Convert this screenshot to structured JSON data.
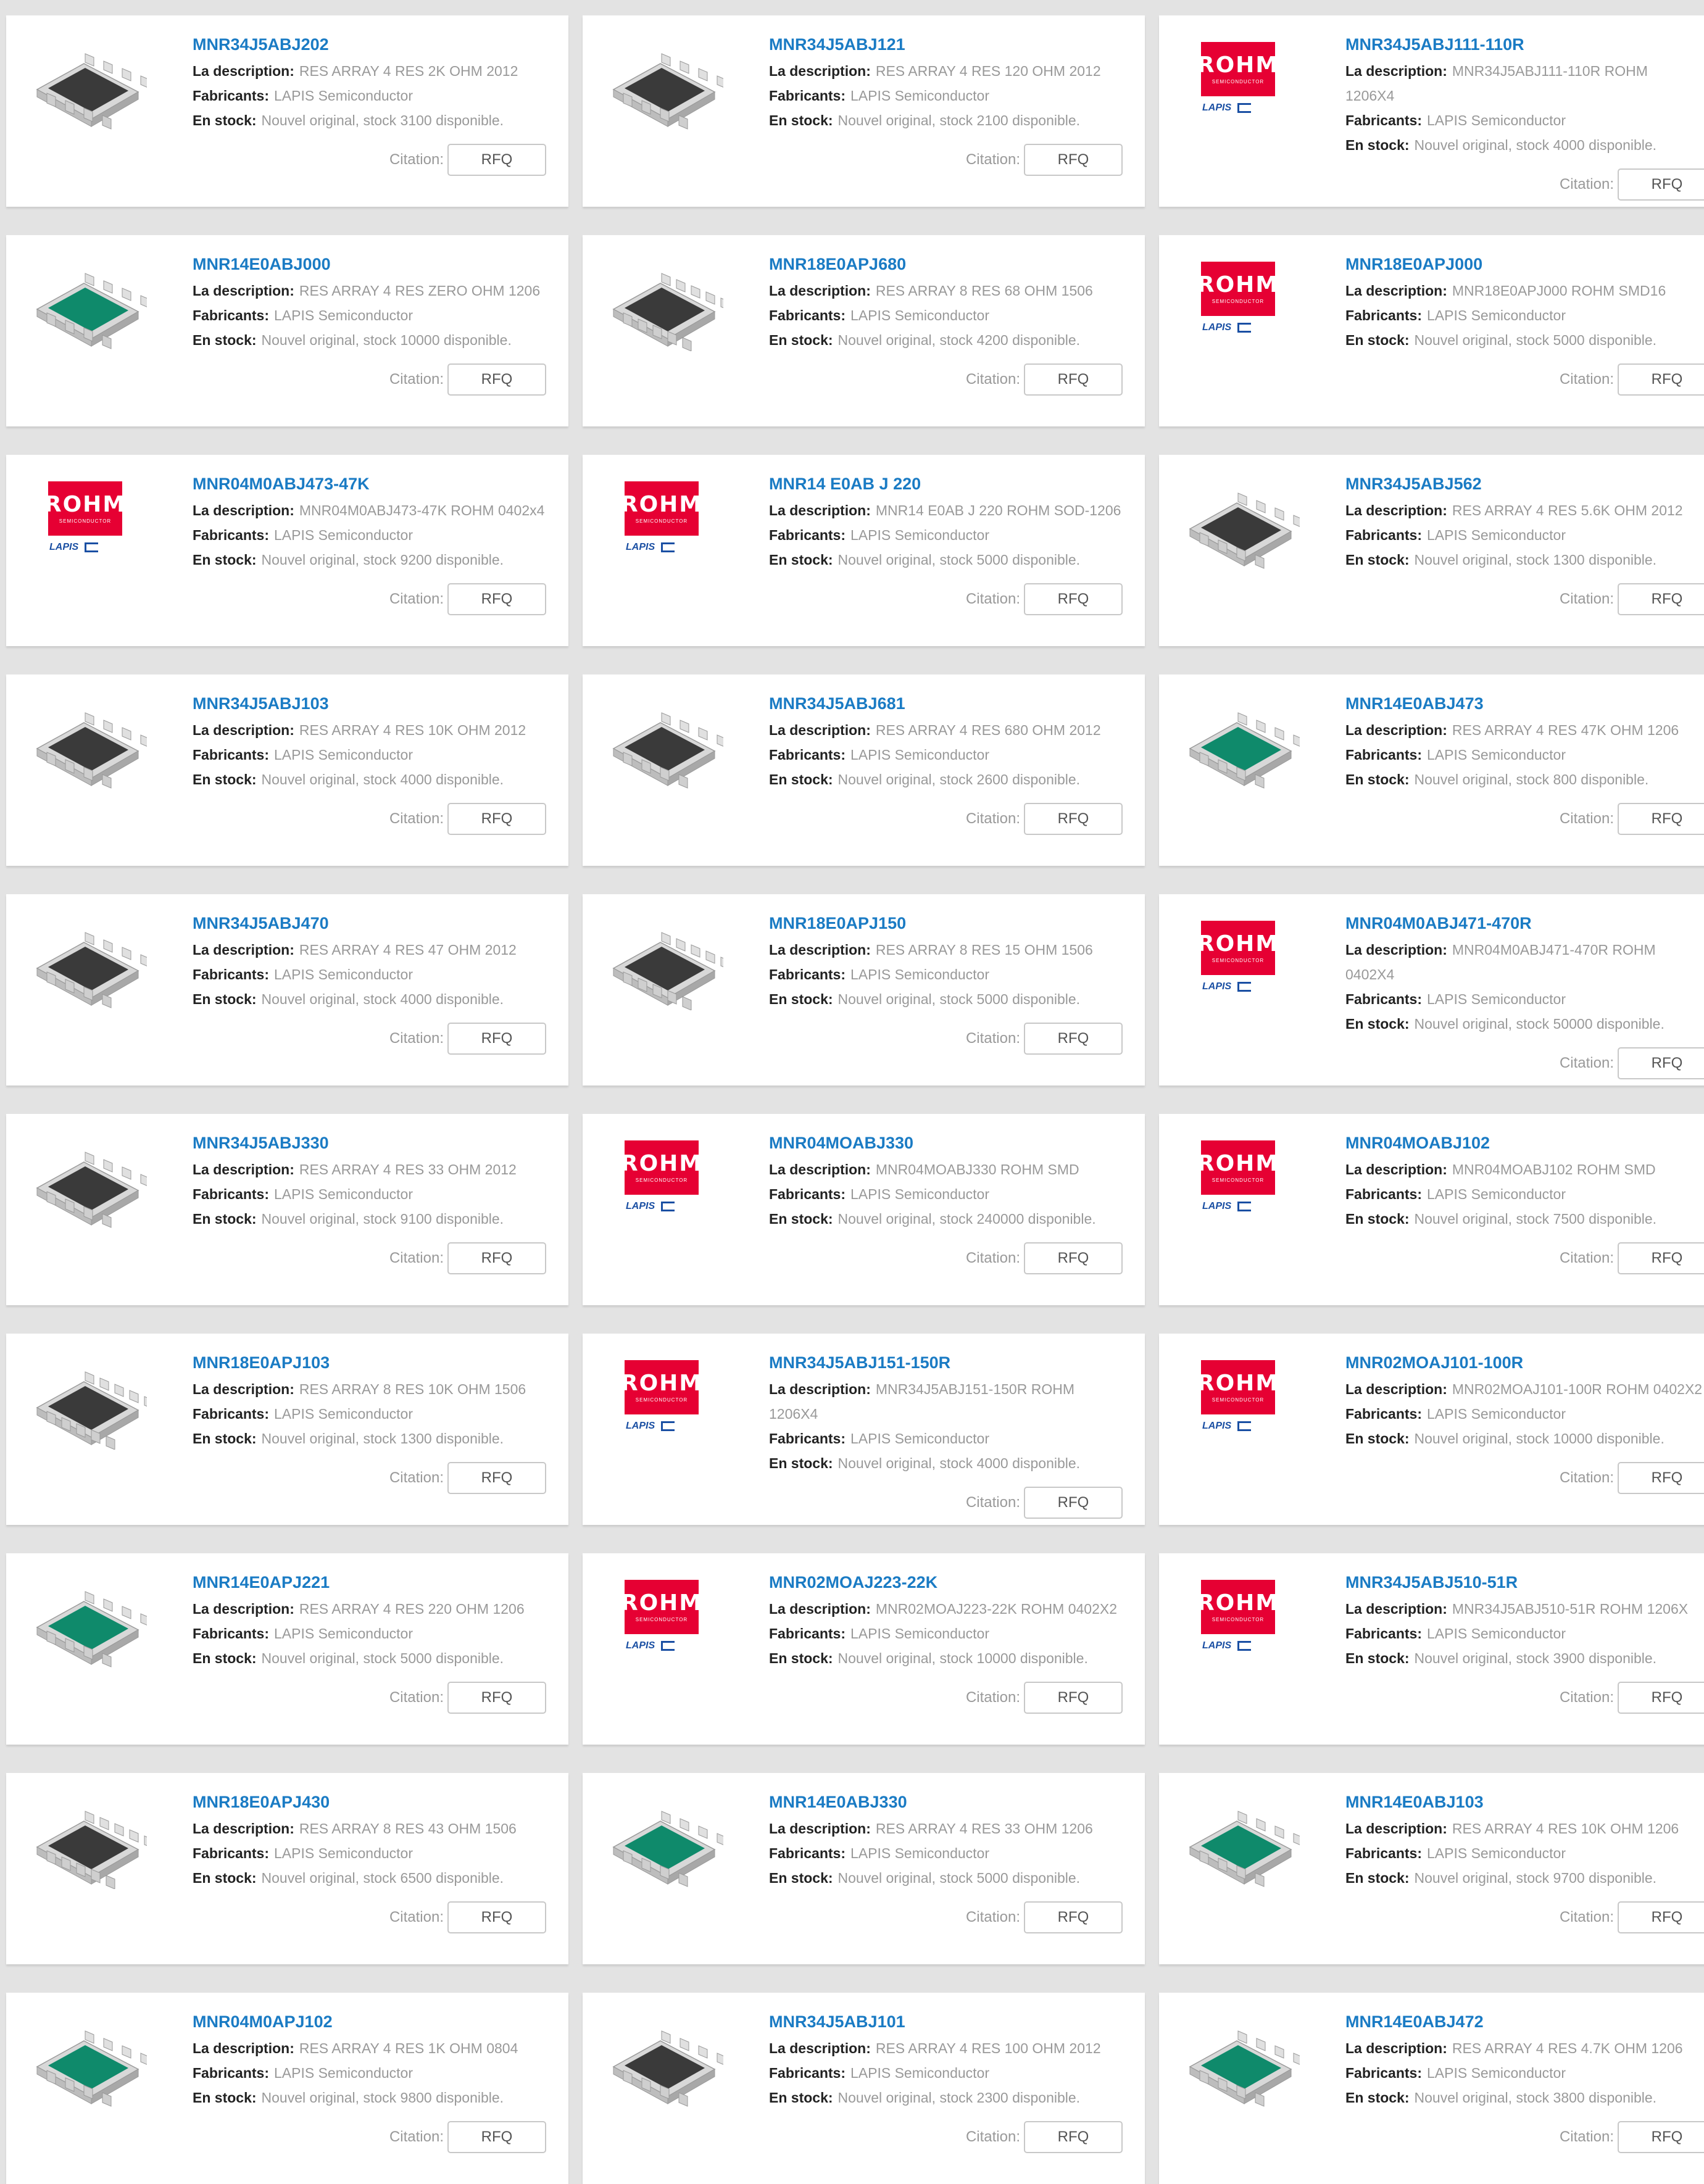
{
  "labels": {
    "description": "La description:",
    "manufacturer": "Fabricants:",
    "stock": "En stock:",
    "citation": "Citation:",
    "rfq": "RFQ"
  },
  "logo": {
    "brand": "ROHM",
    "sub": "SEMICONDUCTOR",
    "lapis": "LAPIS"
  },
  "colors": {
    "link": "#1a7bc4",
    "rohm_red": "#e60033",
    "chip_dark": "#3a3a3a",
    "chip_green": "#0f8a6b"
  },
  "products": [
    {
      "pn": "MNR34J5ABJ202",
      "desc": "RES ARRAY 4 RES 2K OHM 2012",
      "mfr": "LAPIS Semiconductor",
      "stock": "Nouvel original, stock 3100 disponible.",
      "img": "chip-dark-4"
    },
    {
      "pn": "MNR34J5ABJ121",
      "desc": "RES ARRAY 4 RES 120 OHM 2012",
      "mfr": "LAPIS Semiconductor",
      "stock": "Nouvel original, stock 2100 disponible.",
      "img": "chip-dark-4"
    },
    {
      "pn": "MNR34J5ABJ111-110R",
      "desc": "MNR34J5ABJ111-110R ROHM 1206X4",
      "mfr": "LAPIS Semiconductor",
      "stock": "Nouvel original, stock 4000 disponible.",
      "img": "logo"
    },
    {
      "pn": "MNR14E0ABJ000",
      "desc": "RES ARRAY 4 RES ZERO OHM 1206",
      "mfr": "LAPIS Semiconductor",
      "stock": "Nouvel original, stock 10000 disponible.",
      "img": "chip-green-4"
    },
    {
      "pn": "MNR18E0APJ680",
      "desc": "RES ARRAY 8 RES 68 OHM 1506",
      "mfr": "LAPIS Semiconductor",
      "stock": "Nouvel original, stock 4200 disponible.",
      "img": "chip-dark-8"
    },
    {
      "pn": "MNR18E0APJ000",
      "desc": "MNR18E0APJ000 ROHM SMD16",
      "mfr": "LAPIS Semiconductor",
      "stock": "Nouvel original, stock 5000 disponible.",
      "img": "logo"
    },
    {
      "pn": "MNR04M0ABJ473-47K",
      "desc": "MNR04M0ABJ473-47K ROHM 0402x4",
      "mfr": "LAPIS Semiconductor",
      "stock": "Nouvel original, stock 9200 disponible.",
      "img": "logo"
    },
    {
      "pn": "MNR14 E0AB J 220",
      "desc": "MNR14 E0AB J 220 ROHM SOD-1206",
      "mfr": "LAPIS Semiconductor",
      "stock": "Nouvel original, stock 5000 disponible.",
      "img": "logo"
    },
    {
      "pn": "MNR34J5ABJ562",
      "desc": "RES ARRAY 4 RES 5.6K OHM 2012",
      "mfr": "LAPIS Semiconductor",
      "stock": "Nouvel original, stock 1300 disponible.",
      "img": "chip-dark-4"
    },
    {
      "pn": "MNR34J5ABJ103",
      "desc": "RES ARRAY 4 RES 10K OHM 2012",
      "mfr": "LAPIS Semiconductor",
      "stock": "Nouvel original, stock 4000 disponible.",
      "img": "chip-dark-4"
    },
    {
      "pn": "MNR34J5ABJ681",
      "desc": "RES ARRAY 4 RES 680 OHM 2012",
      "mfr": "LAPIS Semiconductor",
      "stock": "Nouvel original, stock 2600 disponible.",
      "img": "chip-dark-4"
    },
    {
      "pn": "MNR14E0ABJ473",
      "desc": "RES ARRAY 4 RES 47K OHM 1206",
      "mfr": "LAPIS Semiconductor",
      "stock": "Nouvel original, stock 800 disponible.",
      "img": "chip-green-4"
    },
    {
      "pn": "MNR34J5ABJ470",
      "desc": "RES ARRAY 4 RES 47 OHM 2012",
      "mfr": "LAPIS Semiconductor",
      "stock": "Nouvel original, stock 4000 disponible.",
      "img": "chip-dark-4"
    },
    {
      "pn": "MNR18E0APJ150",
      "desc": "RES ARRAY 8 RES 15 OHM 1506",
      "mfr": "LAPIS Semiconductor",
      "stock": "Nouvel original, stock 5000 disponible.",
      "img": "chip-dark-8"
    },
    {
      "pn": "MNR04M0ABJ471-470R",
      "desc": "MNR04M0ABJ471-470R ROHM 0402X4",
      "mfr": "LAPIS Semiconductor",
      "stock": "Nouvel original, stock 50000 disponible.",
      "img": "logo"
    },
    {
      "pn": "MNR34J5ABJ330",
      "desc": "RES ARRAY 4 RES 33 OHM 2012",
      "mfr": "LAPIS Semiconductor",
      "stock": "Nouvel original, stock 9100 disponible.",
      "img": "chip-dark-4"
    },
    {
      "pn": "MNR04MOABJ330",
      "desc": "MNR04MOABJ330 ROHM SMD",
      "mfr": "LAPIS Semiconductor",
      "stock": "Nouvel original, stock 240000 disponible.",
      "img": "logo"
    },
    {
      "pn": "MNR04MOABJ102",
      "desc": "MNR04MOABJ102 ROHM SMD",
      "mfr": "LAPIS Semiconductor",
      "stock": "Nouvel original, stock 7500 disponible.",
      "img": "logo"
    },
    {
      "pn": "MNR18E0APJ103",
      "desc": "RES ARRAY 8 RES 10K OHM 1506",
      "mfr": "LAPIS Semiconductor",
      "stock": "Nouvel original, stock 1300 disponible.",
      "img": "chip-dark-8"
    },
    {
      "pn": "MNR34J5ABJ151-150R",
      "desc": "MNR34J5ABJ151-150R ROHM 1206X4",
      "mfr": "LAPIS Semiconductor",
      "stock": "Nouvel original, stock 4000 disponible.",
      "img": "logo"
    },
    {
      "pn": "MNR02MOAJ101-100R",
      "desc": "MNR02MOAJ101-100R ROHM 0402X2",
      "mfr": "LAPIS Semiconductor",
      "stock": "Nouvel original, stock 10000 disponible.",
      "img": "logo"
    },
    {
      "pn": "MNR14E0APJ221",
      "desc": "RES ARRAY 4 RES 220 OHM 1206",
      "mfr": "LAPIS Semiconductor",
      "stock": "Nouvel original, stock 5000 disponible.",
      "img": "chip-green-4"
    },
    {
      "pn": "MNR02MOAJ223-22K",
      "desc": "MNR02MOAJ223-22K ROHM 0402X2",
      "mfr": "LAPIS Semiconductor",
      "stock": "Nouvel original, stock 10000 disponible.",
      "img": "logo"
    },
    {
      "pn": "MNR34J5ABJ510-51R",
      "desc": "MNR34J5ABJ510-51R ROHM 1206X",
      "mfr": "LAPIS Semiconductor",
      "stock": "Nouvel original, stock 3900 disponible.",
      "img": "logo"
    },
    {
      "pn": "MNR18E0APJ430",
      "desc": "RES ARRAY 8 RES 43 OHM 1506",
      "mfr": "LAPIS Semiconductor",
      "stock": "Nouvel original, stock 6500 disponible.",
      "img": "chip-dark-8"
    },
    {
      "pn": "MNR14E0ABJ330",
      "desc": "RES ARRAY 4 RES 33 OHM 1206",
      "mfr": "LAPIS Semiconductor",
      "stock": "Nouvel original, stock 5000 disponible.",
      "img": "chip-green-4"
    },
    {
      "pn": "MNR14E0ABJ103",
      "desc": "RES ARRAY 4 RES 10K OHM 1206",
      "mfr": "LAPIS Semiconductor",
      "stock": "Nouvel original, stock 9700 disponible.",
      "img": "chip-green-4"
    },
    {
      "pn": "MNR04M0APJ102",
      "desc": "RES ARRAY 4 RES 1K OHM 0804",
      "mfr": "LAPIS Semiconductor",
      "stock": "Nouvel original, stock 9800 disponible.",
      "img": "chip-green-4"
    },
    {
      "pn": "MNR34J5ABJ101",
      "desc": "RES ARRAY 4 RES 100 OHM 2012",
      "mfr": "LAPIS Semiconductor",
      "stock": "Nouvel original, stock 2300 disponible.",
      "img": "chip-dark-4"
    },
    {
      "pn": "MNR14E0ABJ472",
      "desc": "RES ARRAY 4 RES 4.7K OHM 1206",
      "mfr": "LAPIS Semiconductor",
      "stock": "Nouvel original, stock 3800 disponible.",
      "img": "chip-green-4"
    }
  ]
}
